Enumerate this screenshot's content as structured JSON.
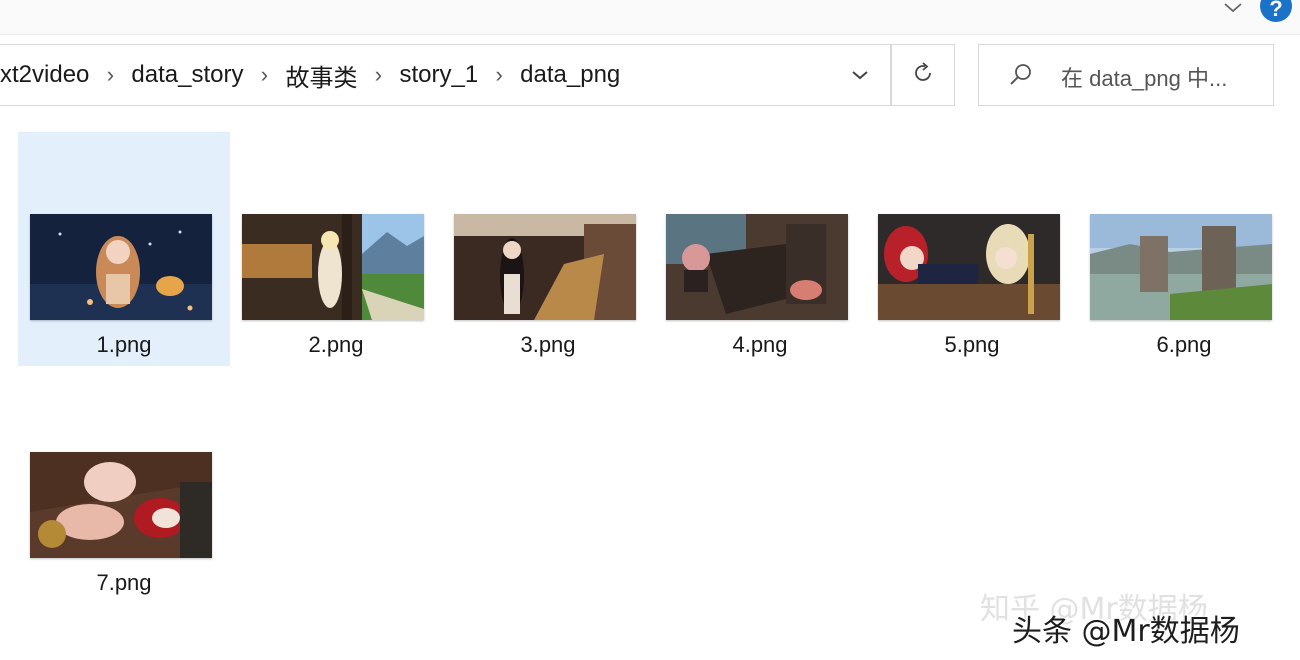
{
  "breadcrumb": [
    "xt2video",
    "data_story",
    "故事类",
    "story_1",
    "data_png"
  ],
  "search": {
    "placeholder": "在 data_png 中..."
  },
  "files": [
    {
      "name": "1.png",
      "selected": true
    },
    {
      "name": "2.png",
      "selected": false
    },
    {
      "name": "3.png",
      "selected": false
    },
    {
      "name": "4.png",
      "selected": false
    },
    {
      "name": "5.png",
      "selected": false
    },
    {
      "name": "6.png",
      "selected": false
    },
    {
      "name": "7.png",
      "selected": false
    }
  ],
  "watermark": {
    "light": "知乎 @Mr数据杨",
    "dark": "头条 @Mr数据杨"
  },
  "icons": {
    "separator": "chevron-right-icon",
    "history": "chevron-down-icon",
    "refresh": "refresh-icon",
    "search": "search-icon",
    "help": "help-icon",
    "expand": "expand-ribbon-icon"
  },
  "colors": {
    "selection": "#e3effb",
    "help_button": "#1a73c9"
  }
}
